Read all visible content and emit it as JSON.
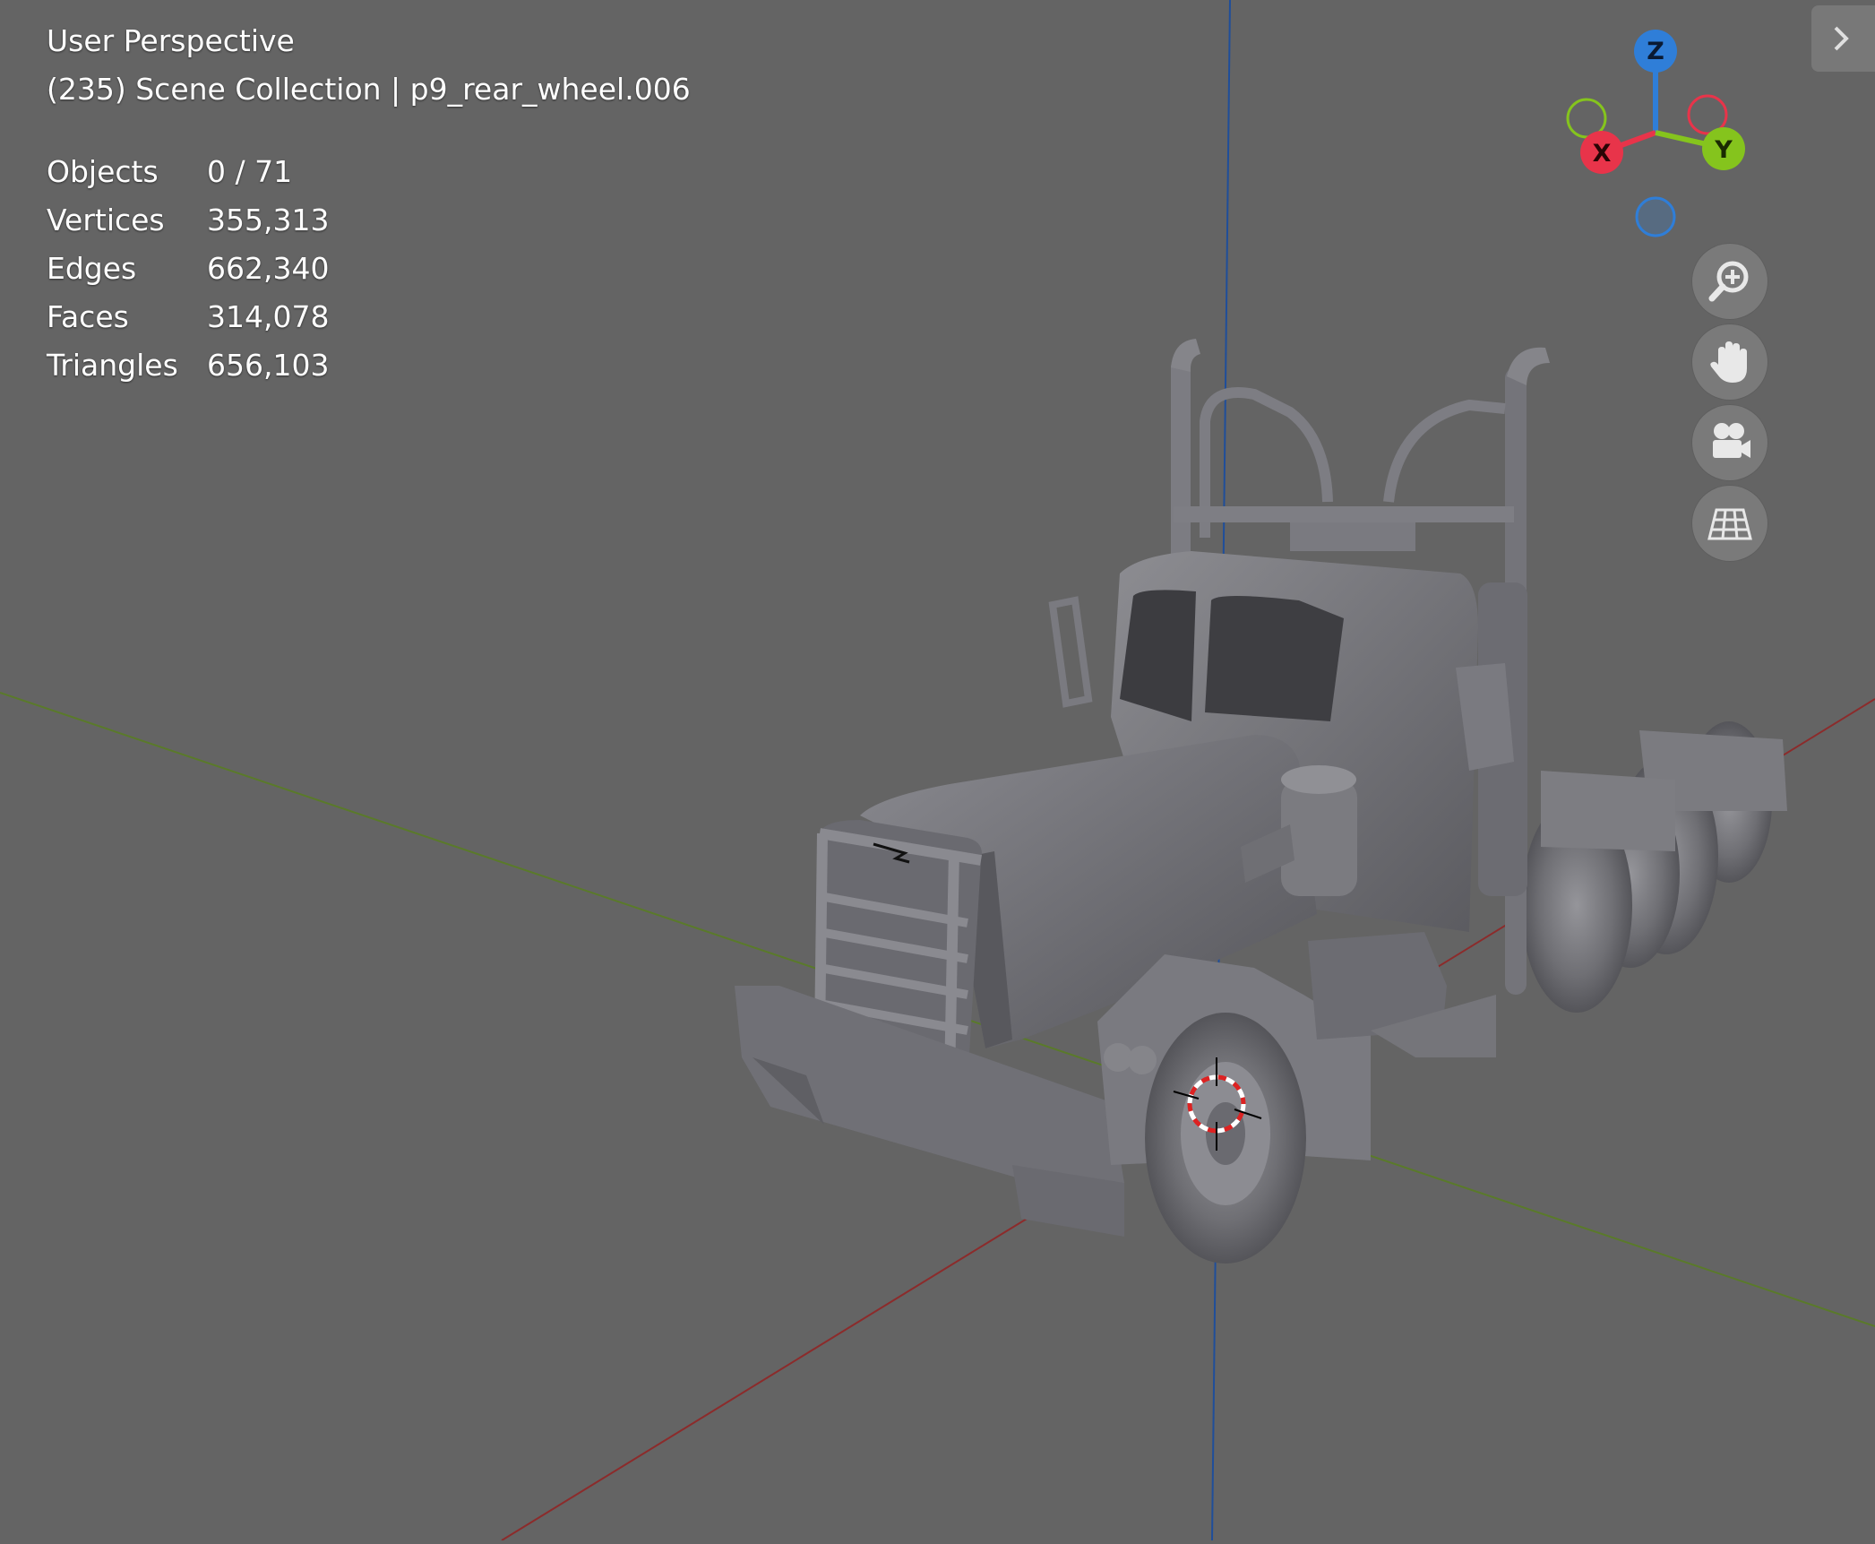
{
  "viewport": {
    "view_name": "User Perspective",
    "collection_info": "(235) Scene Collection | p9_rear_wheel.006"
  },
  "stats": [
    {
      "name": "Objects",
      "value": "0 / 71"
    },
    {
      "name": "Vertices",
      "value": "355,313"
    },
    {
      "name": "Edges",
      "value": "662,340"
    },
    {
      "name": "Faces",
      "value": "314,078"
    },
    {
      "name": "Triangles",
      "value": "656,103"
    }
  ],
  "gizmo": {
    "z_label": "Z",
    "x_label": "X",
    "y_label": "Y"
  },
  "nav_buttons": [
    {
      "name": "zoom",
      "icon": "zoom-in-icon"
    },
    {
      "name": "pan",
      "icon": "hand-icon"
    },
    {
      "name": "camera",
      "icon": "camera-icon"
    },
    {
      "name": "ortho",
      "icon": "grid-icon"
    }
  ],
  "colors": {
    "background": "#646464",
    "axis_x": "#e8344a",
    "axis_y": "#85c41d",
    "axis_z": "#2f7ed8",
    "floor_x_line": "#8c2b2b",
    "floor_y_line": "#5a7a2a",
    "z_line": "#1f4e9a"
  }
}
